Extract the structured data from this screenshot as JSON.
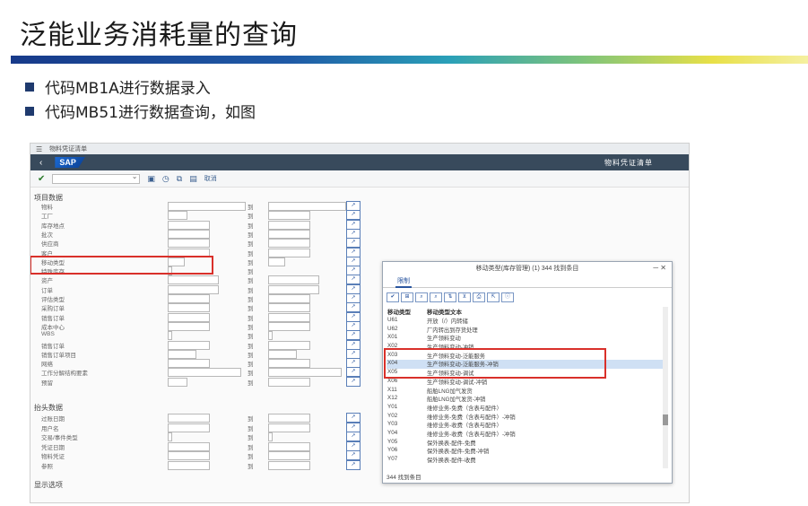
{
  "slide": {
    "title": "泛能业务消耗量的查询",
    "bullets": [
      "代码MB1A进行数据录入",
      "代码MB51进行数据查询，如图"
    ]
  },
  "sap": {
    "window_title": "物料凭证清单",
    "logo": "SAP",
    "app_title": "物料凭证清单",
    "toolbar_exec": "取消",
    "section_item": "项目数据",
    "section_header": "抬头数据",
    "section_display": "显示选项",
    "to_label": "到",
    "item_rows": [
      "物料",
      "工厂",
      "库存地点",
      "批次",
      "供应商",
      "客户",
      "移动类型",
      "特殊库存",
      "资产",
      "订单",
      "评估类型",
      "采购订单",
      "销售订单",
      "成本中心",
      "WBS",
      "销售订单",
      "销售订单项目",
      "网络",
      "工作分解结构要素",
      "预留"
    ],
    "header_rows": [
      "过账日期",
      "用户名",
      "交易/事件类型",
      "凭证日期",
      "物料凭证",
      "参照"
    ]
  },
  "popup": {
    "title": "移动类型(库存管理) (1) 344 找到条目",
    "tab": "限制",
    "col1": "移动类型",
    "col2": "移动类型文本",
    "rows": [
      {
        "code": "U61",
        "text": "开放（/）内转储",
        "selected": false
      },
      {
        "code": "U62",
        "text": "厂内转出到存货处理",
        "selected": false
      },
      {
        "code": "X01",
        "text": "生产领料变动",
        "selected": false
      },
      {
        "code": "X02",
        "text": "生产领料变动-冲销",
        "selected": false
      },
      {
        "code": "X03",
        "text": "生产领料变动-泛能服务",
        "selected": false
      },
      {
        "code": "X04",
        "text": "生产领料变动-泛能服务-冲销",
        "selected": true
      },
      {
        "code": "X05",
        "text": "生产领料变动-调试",
        "selected": false
      },
      {
        "code": "X06",
        "text": "生产领料变动-调试-冲销",
        "selected": false
      },
      {
        "code": "X11",
        "text": "船舶LNG加气发货",
        "selected": false
      },
      {
        "code": "X12",
        "text": "船舶LNG加气发货-冲销",
        "selected": false
      },
      {
        "code": "Y01",
        "text": "维修业务-免费（含表与配件）",
        "selected": false
      },
      {
        "code": "Y02",
        "text": "维修业务-免费（含表与配件）-冲销",
        "selected": false
      },
      {
        "code": "Y03",
        "text": "维修业务-收费（含表与配件）",
        "selected": false
      },
      {
        "code": "Y04",
        "text": "维修业务-收费（含表与配件）-冲销",
        "selected": false
      },
      {
        "code": "Y05",
        "text": "保外换表-配件-免费",
        "selected": false
      },
      {
        "code": "Y06",
        "text": "保外换表-配件-免费-冲销",
        "selected": false
      },
      {
        "code": "Y07",
        "text": "保外换表-配件-收费",
        "selected": false
      }
    ],
    "footer": "344 找到条目"
  }
}
